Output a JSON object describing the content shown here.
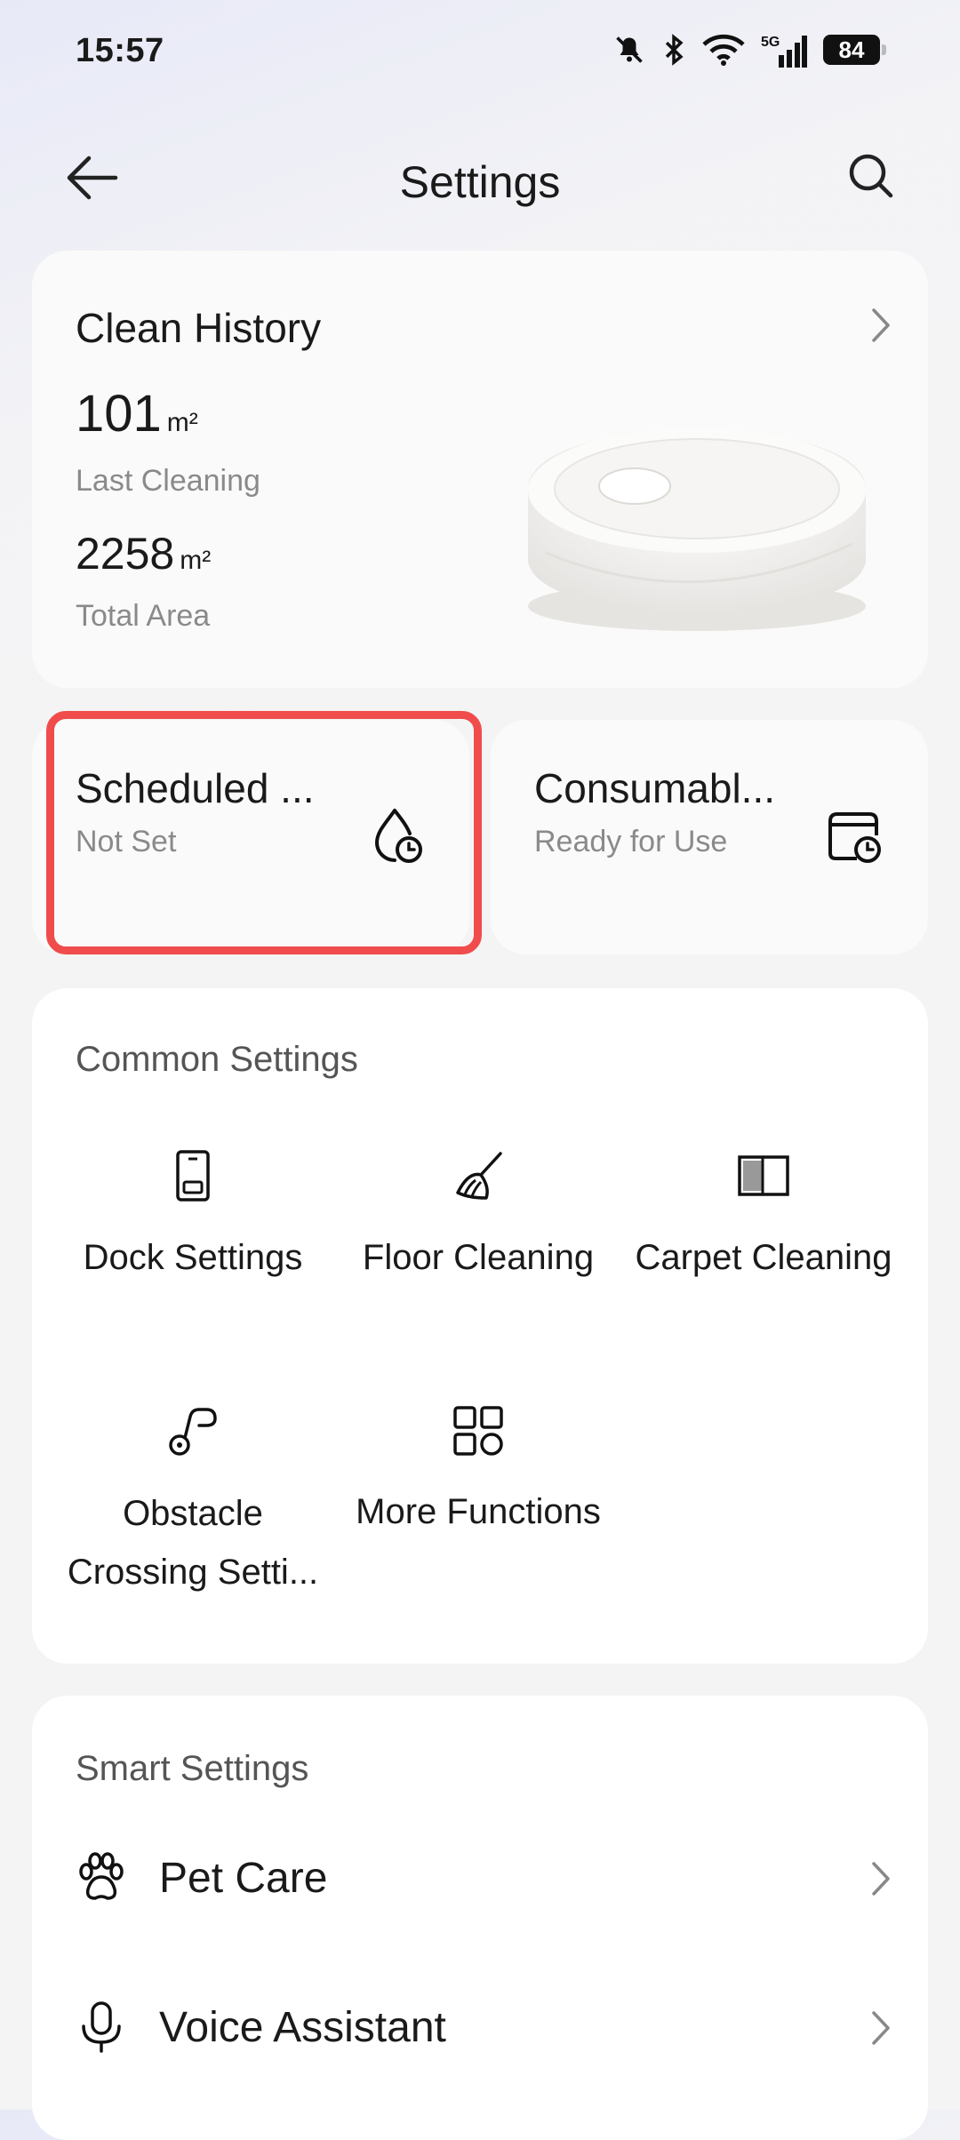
{
  "status_bar": {
    "time": "15:57",
    "signal_label": "5G",
    "battery": "84"
  },
  "header": {
    "title": "Settings"
  },
  "clean_history": {
    "title": "Clean History",
    "last_value": "101",
    "last_unit": "m²",
    "last_label": "Last Cleaning",
    "total_value": "2258",
    "total_unit": "m²",
    "total_label": "Total Area"
  },
  "scheduled": {
    "title": "Scheduled ...",
    "subtitle": "Not Set"
  },
  "consumables": {
    "title": "Consumabl...",
    "subtitle": "Ready for Use"
  },
  "common_settings": {
    "title": "Common Settings",
    "items": [
      {
        "label": "Dock Settings",
        "icon": "dock-icon"
      },
      {
        "label": "Floor Cleaning",
        "icon": "mop-icon"
      },
      {
        "label": "Carpet Cleaning",
        "icon": "carpet-icon"
      },
      {
        "label_line1": "Obstacle",
        "label_line2": "Crossing Setti...",
        "icon": "obstacle-icon"
      },
      {
        "label": "More Functions",
        "icon": "grid-icon"
      }
    ]
  },
  "smart_settings": {
    "title": "Smart Settings",
    "items": [
      {
        "label": "Pet Care",
        "icon": "paw-icon"
      },
      {
        "label": "Voice Assistant",
        "icon": "microphone-icon"
      }
    ]
  },
  "colors": {
    "highlight": "#f04c4c",
    "background": "#f4f4f4",
    "card": "#ffffff"
  }
}
